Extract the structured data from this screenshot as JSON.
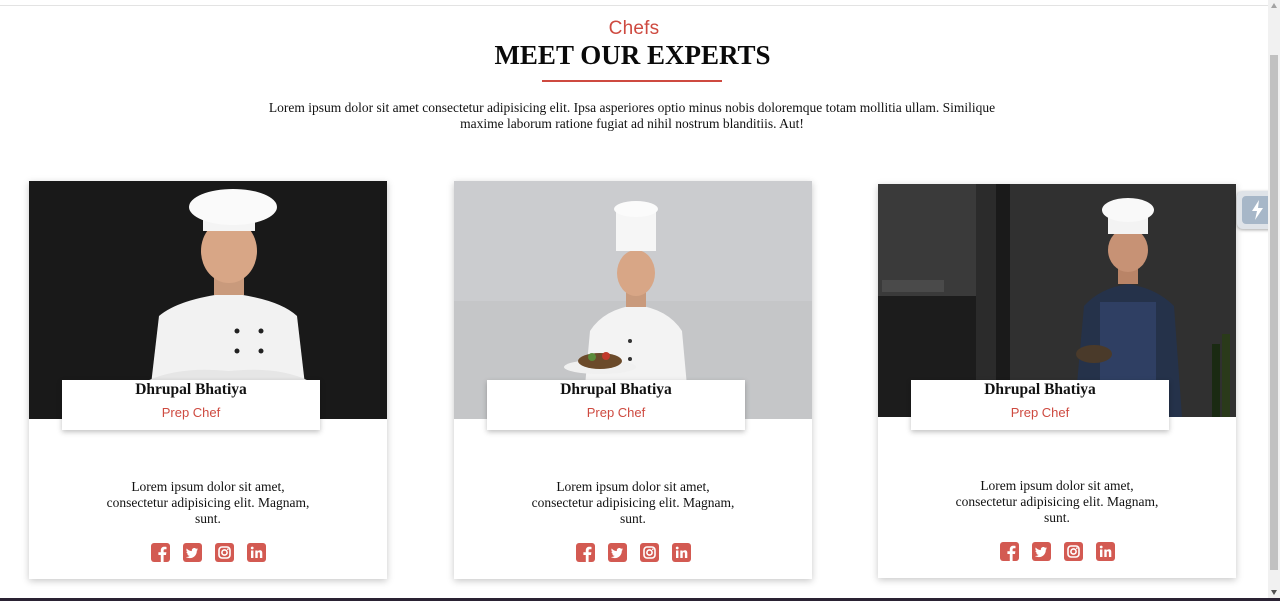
{
  "section": {
    "tag": "Chefs",
    "title": "MEET OUR EXPERTS",
    "intro": "Lorem ipsum dolor sit amet consectetur adipisicing elit. Ipsa asperiores optio minus nobis doloremque totam mollitia ullam. Similique maxime laborum ratione fugiat ad nihil nostrum blanditiis. Aut!"
  },
  "chefs": [
    {
      "name": "Dhrupal Bhatiya",
      "role": "Prep Chef",
      "bio": "Lorem ipsum dolor sit amet, consectetur adipisicing elit. Magnam, sunt."
    },
    {
      "name": "Dhrupal Bhatiya",
      "role": "Prep Chef",
      "bio": "Lorem ipsum dolor sit amet, consectetur adipisicing elit. Magnam, sunt."
    },
    {
      "name": "Dhrupal Bhatiya",
      "role": "Prep Chef",
      "bio": "Lorem ipsum dolor sit amet, consectetur adipisicing elit. Magnam, sunt."
    }
  ],
  "social_icons": [
    "facebook-icon",
    "twitter-icon",
    "instagram-icon",
    "linkedin-icon"
  ],
  "colors": {
    "accent": "#ce4a40",
    "title": "#0a0a0a",
    "social": "#d35a52"
  }
}
